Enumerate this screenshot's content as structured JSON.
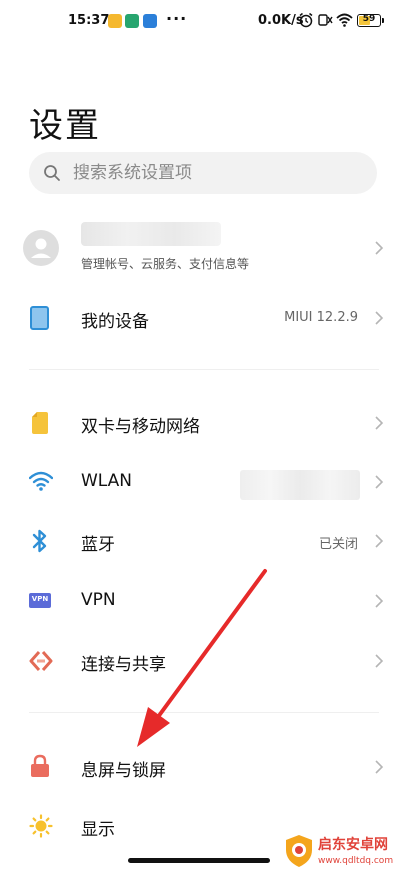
{
  "status_bar": {
    "time": "15:37",
    "dots": "···",
    "net_speed": "0.0K/s",
    "battery_level": 59,
    "battery_label": "59",
    "icons": [
      "notification-yellow-icon",
      "notification-green-icon",
      "notification-blue-icon",
      "alarm-icon",
      "signal-x-icon",
      "wifi-icon"
    ]
  },
  "header": {
    "title": "设置"
  },
  "search": {
    "placeholder": "搜索系统设置项"
  },
  "account": {
    "subtitle": "管理帐号、云服务、支付信息等"
  },
  "device": {
    "label": "我的设备",
    "value": "MIUI 12.2.9"
  },
  "network": [
    {
      "label": "双卡与移动网络",
      "icon": "sim-card-icon",
      "value": ""
    },
    {
      "label": "WLAN",
      "icon": "wifi-icon",
      "value": ""
    },
    {
      "label": "蓝牙",
      "icon": "bluetooth-icon",
      "value": "已关闭"
    },
    {
      "label": "VPN",
      "icon": "vpn-icon",
      "value": ""
    },
    {
      "label": "连接与共享",
      "icon": "connection-share-icon",
      "value": ""
    }
  ],
  "vpn_badge": "VPN",
  "display_section": [
    {
      "label": "息屏与锁屏",
      "icon": "lock-icon"
    },
    {
      "label": "显示",
      "icon": "sun-icon"
    }
  ],
  "watermark": {
    "name": "启东安卓网",
    "url": "www.qdltdq.com"
  },
  "colors": {
    "accent_blue": "#2e8fd6",
    "sim_yellow": "#f5c33b",
    "vpn_purple": "#5b6bd8",
    "connection_red": "#e26a55",
    "lock_red": "#ea6c5e",
    "sun_yellow": "#f7c12d",
    "arrow_red": "#e62a2a"
  }
}
